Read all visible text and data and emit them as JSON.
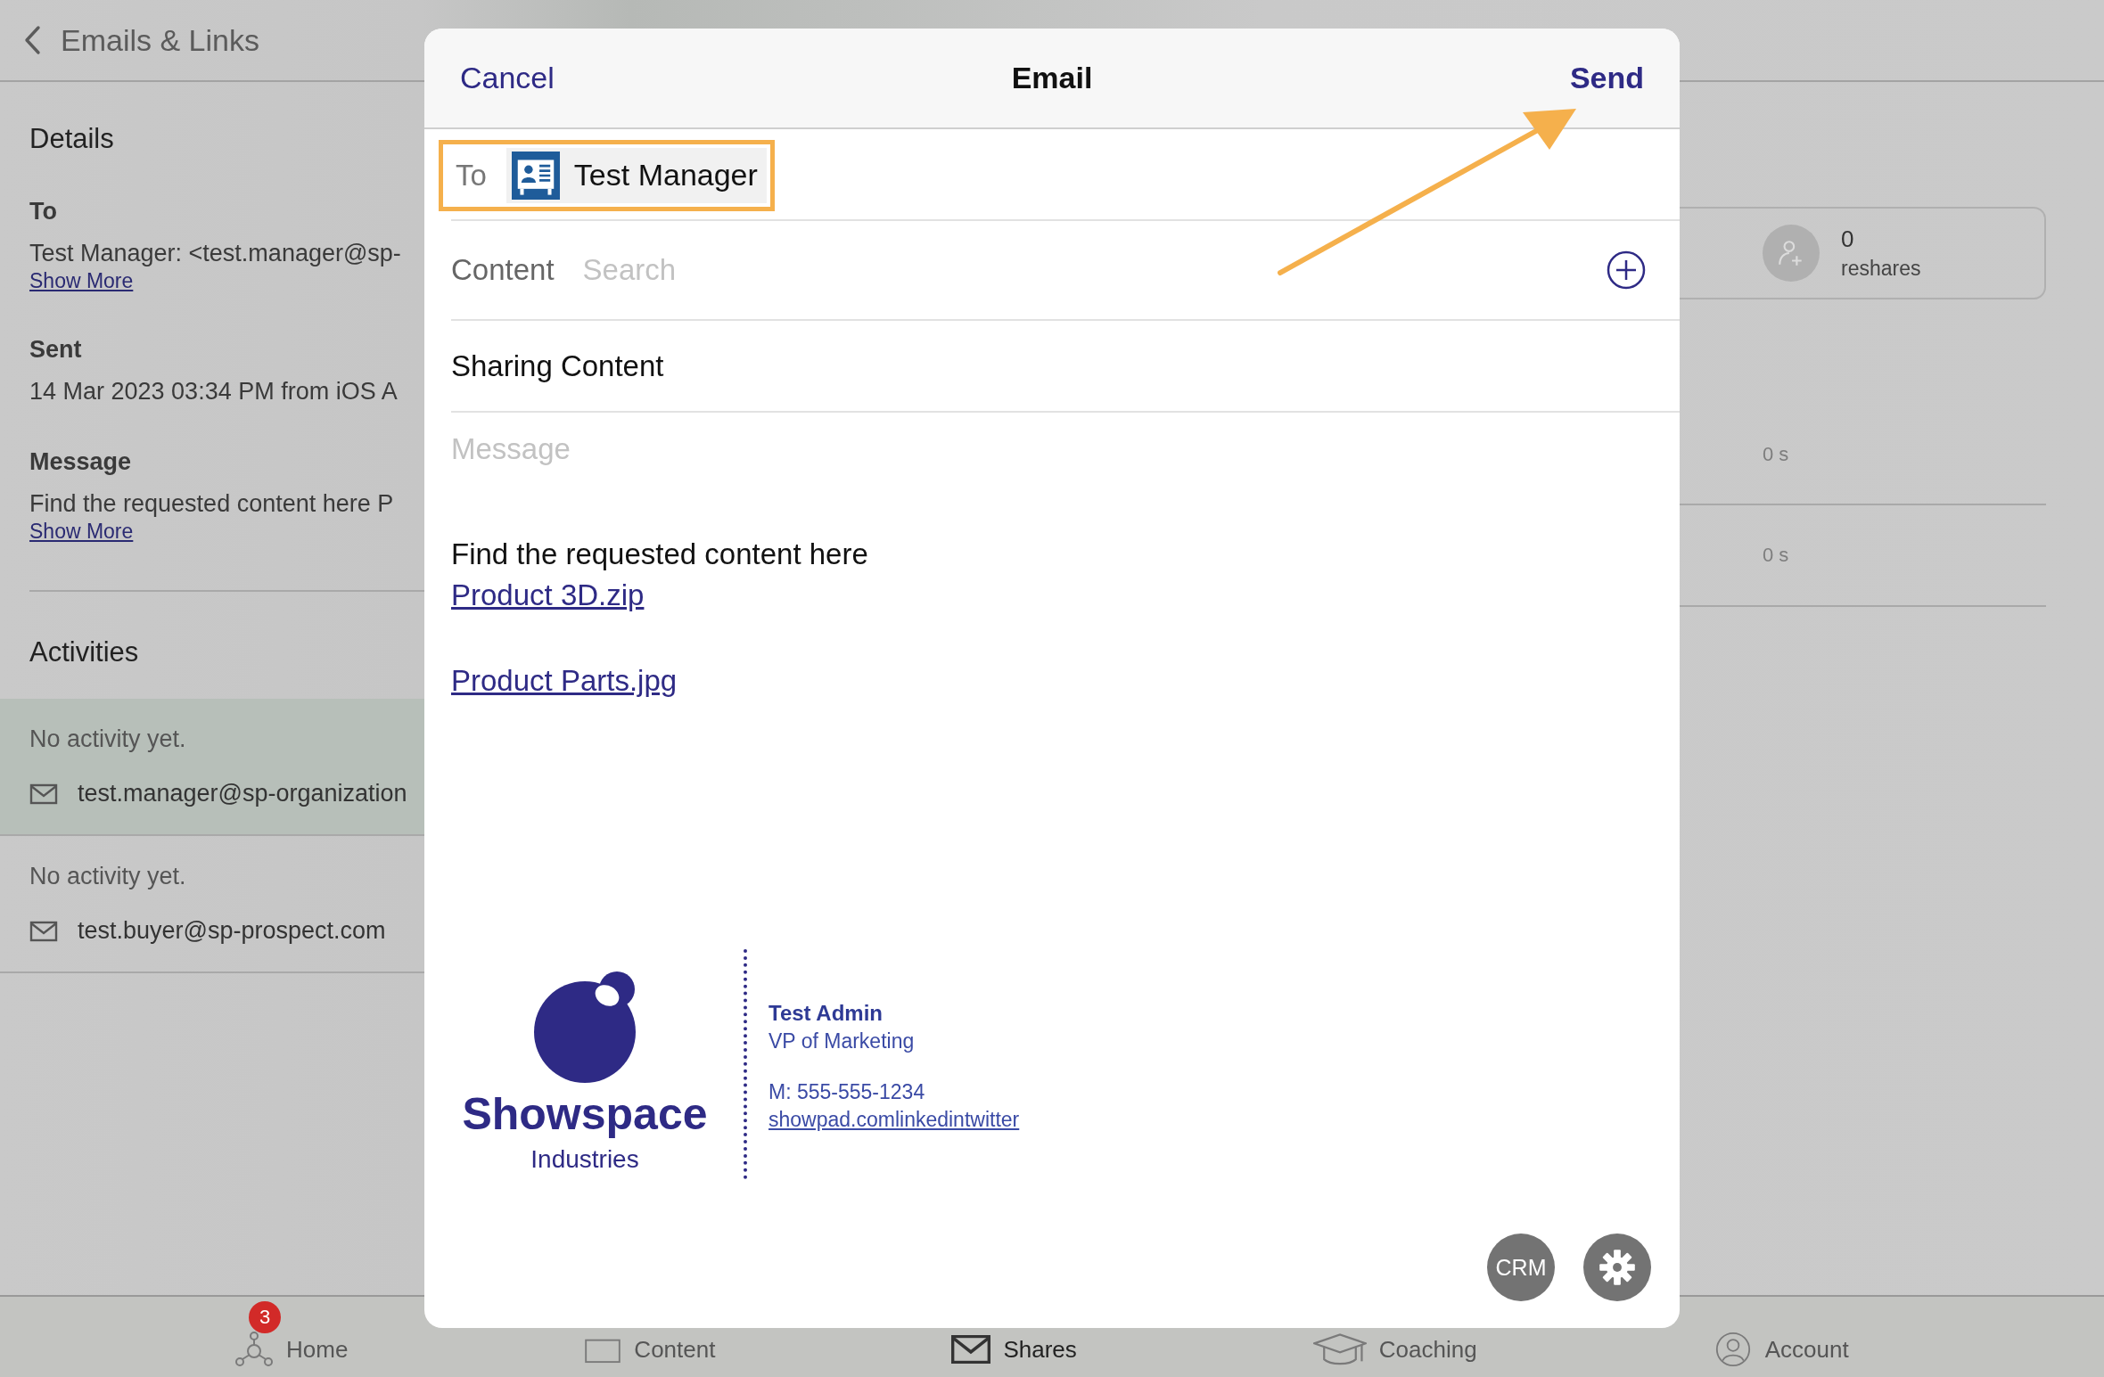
{
  "nav": {
    "back_label": "Emails & Links"
  },
  "details": {
    "heading": "Details",
    "fields": [
      {
        "label": "To",
        "value": "Test Manager: <test.manager@sp-",
        "link": "Show More"
      },
      {
        "label": "Sent",
        "value": "14 Mar 2023 03:34 PM from iOS A"
      },
      {
        "label": "Message",
        "value": "Find the requested content here P",
        "link": "Show More"
      }
    ]
  },
  "activities": {
    "heading": "Activities",
    "items": [
      {
        "status": "No activity yet.",
        "email": "test.manager@sp-organization",
        "selected": true
      },
      {
        "status": "No activity yet.",
        "email": "test.buyer@sp-prospect.com",
        "selected": false
      }
    ]
  },
  "stats": {
    "reshares": {
      "count": "0",
      "label": "reshares"
    },
    "durations": [
      "0 s",
      "0 s"
    ]
  },
  "tab_bar": [
    {
      "label": "Home",
      "kind": "home",
      "badge": "3",
      "selected": false
    },
    {
      "label": "Content",
      "kind": "content",
      "selected": false
    },
    {
      "label": "Shares",
      "kind": "shares",
      "selected": true
    },
    {
      "label": "Coaching",
      "kind": "coaching",
      "selected": false
    },
    {
      "label": "Account",
      "kind": "account",
      "selected": false
    }
  ],
  "email_sheet": {
    "cancel": "Cancel",
    "title": "Email",
    "send": "Send",
    "callout_arrow": true,
    "to": {
      "label": "To",
      "recipient": "Test Manager",
      "highlighted": true
    },
    "content": {
      "label": "Content",
      "placeholder": "Search"
    },
    "subject": "Sharing Content",
    "message": {
      "label": "Message",
      "body": "Find the requested content here",
      "links": [
        "Product 3D.zip",
        "Product Parts.jpg"
      ]
    },
    "signature": {
      "company": "Showspace",
      "division": "Industries",
      "name": "Test Admin",
      "title": "VP of Marketing",
      "phone": "M: 555-555-1234",
      "links": "showpad.comlinkedintwitter"
    },
    "actions": [
      {
        "kind": "text",
        "label": "CRM"
      },
      {
        "kind": "settings"
      }
    ]
  }
}
